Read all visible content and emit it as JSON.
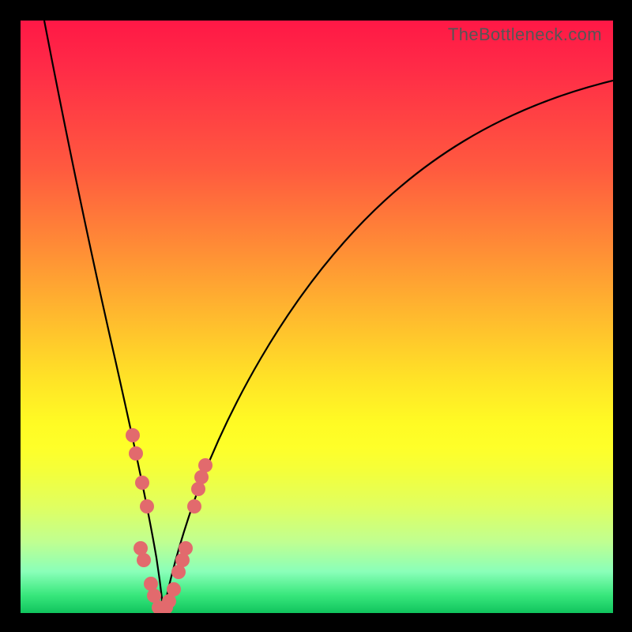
{
  "watermark": "TheBottleneck.com",
  "colors": {
    "frame": "#000000",
    "gradient_top": "#ff1846",
    "gradient_bottom": "#10c45d",
    "curve": "#000000",
    "dots": "#e26a6d"
  },
  "chart_data": {
    "type": "line",
    "title": "",
    "xlabel": "",
    "ylabel": "",
    "xlim": [
      0,
      100
    ],
    "ylim": [
      0,
      100
    ],
    "vertex_x": 24,
    "series": [
      {
        "name": "left-branch",
        "x": [
          4,
          6,
          8,
          10,
          12,
          14,
          16,
          18,
          20,
          21,
          22,
          23,
          23.5,
          24
        ],
        "y": [
          100,
          90,
          79,
          68,
          57,
          46,
          35,
          25,
          15,
          10,
          6,
          3,
          1.5,
          0
        ]
      },
      {
        "name": "right-branch",
        "x": [
          24,
          25,
          26,
          27,
          28,
          30,
          33,
          37,
          42,
          48,
          55,
          63,
          72,
          82,
          93,
          100
        ],
        "y": [
          0,
          2,
          5,
          9,
          13,
          20,
          29,
          39,
          49,
          58,
          66,
          73,
          79,
          84,
          88,
          90
        ]
      }
    ],
    "annotations_dots": [
      {
        "x": 18.9,
        "y": 30
      },
      {
        "x": 19.5,
        "y": 27
      },
      {
        "x": 20.5,
        "y": 22
      },
      {
        "x": 21.3,
        "y": 18
      },
      {
        "x": 20.3,
        "y": 11
      },
      {
        "x": 20.9,
        "y": 9
      },
      {
        "x": 22.0,
        "y": 5
      },
      {
        "x": 22.5,
        "y": 3
      },
      {
        "x": 23.3,
        "y": 1
      },
      {
        "x": 24.5,
        "y": 1
      },
      {
        "x": 25.1,
        "y": 2
      },
      {
        "x": 25.9,
        "y": 4
      },
      {
        "x": 26.7,
        "y": 7
      },
      {
        "x": 27.3,
        "y": 9
      },
      {
        "x": 27.8,
        "y": 11
      },
      {
        "x": 29.3,
        "y": 18
      },
      {
        "x": 30.0,
        "y": 21
      },
      {
        "x": 30.6,
        "y": 23
      },
      {
        "x": 31.2,
        "y": 25
      }
    ]
  }
}
